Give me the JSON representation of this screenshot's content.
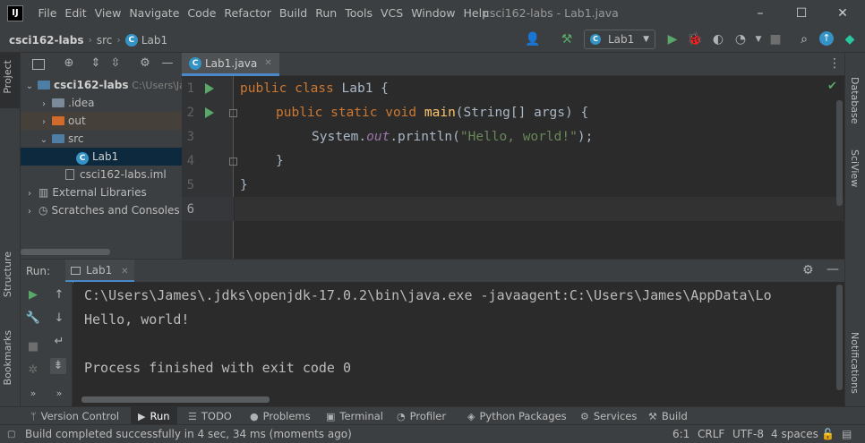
{
  "window": {
    "title": "csci162-labs - Lab1.java",
    "menu": [
      "File",
      "Edit",
      "View",
      "Navigate",
      "Code",
      "Refactor",
      "Build",
      "Run",
      "Tools",
      "VCS",
      "Window",
      "Help"
    ],
    "minimize": "–",
    "maximize": "☐",
    "close": "✕"
  },
  "navbar": {
    "breadcrumbs": [
      "csci162-labs",
      "src",
      "Lab1"
    ],
    "run_config": "Lab1"
  },
  "left_strip": {
    "tabs": [
      "Project",
      "Structure",
      "Bookmarks"
    ]
  },
  "right_strip": {
    "tabs": [
      "Database",
      "SciView",
      "Notifications"
    ]
  },
  "project": {
    "root": {
      "name": "csci162-labs",
      "path": "C:\\Users\\Jar"
    },
    "items": [
      {
        "name": ".idea"
      },
      {
        "name": "out"
      },
      {
        "name": "src"
      },
      {
        "name": "Lab1"
      },
      {
        "name": "csci162-labs.iml"
      },
      {
        "name": "External Libraries"
      },
      {
        "name": "Scratches and Consoles"
      }
    ]
  },
  "editor": {
    "tab_label": "Lab1.java",
    "line_numbers": [
      "1",
      "2",
      "3",
      "4",
      "5",
      "6"
    ],
    "code": {
      "l1_kw": "public class ",
      "l1_name": "Lab1 {",
      "l2_kw": "public static void ",
      "l2_fn": "main",
      "l2_rest": "(String[] args) {",
      "l3_a": "System.",
      "l3_out": "out",
      "l3_b": ".println(",
      "l3_str": "\"Hello, world!\"",
      "l3_c": ");",
      "l4": "}",
      "l5": "}"
    }
  },
  "run_panel": {
    "label": "Run:",
    "tab": "Lab1",
    "console": [
      "C:\\Users\\James\\.jdks\\openjdk-17.0.2\\bin\\java.exe -javaagent:C:\\Users\\James\\AppData\\Lo",
      "Hello, world!",
      "",
      "Process finished with exit code 0"
    ]
  },
  "tool_tabs": [
    "Version Control",
    "Run",
    "TODO",
    "Problems",
    "Terminal",
    "Profiler",
    "Python Packages",
    "Services",
    "Build"
  ],
  "status": {
    "message": "Build completed successfully in 4 sec, 34 ms (moments ago)",
    "position": "6:1",
    "line_sep": "CRLF",
    "encoding": "UTF-8",
    "indent": "4 spaces"
  },
  "colors": {
    "accent": "#4a88c7",
    "run_green": "#59a869",
    "keyword": "#cc7832",
    "function": "#ffc66d",
    "string": "#6a8759"
  }
}
